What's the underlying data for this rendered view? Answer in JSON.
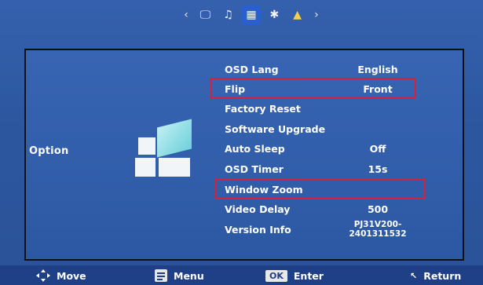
{
  "top_tabs": [
    {
      "name": "display",
      "glyph": "🖵"
    },
    {
      "name": "audio",
      "glyph": "♫"
    },
    {
      "name": "option",
      "glyph": "▦"
    },
    {
      "name": "bluetooth",
      "glyph": "✱"
    },
    {
      "name": "picture",
      "glyph": "▲"
    }
  ],
  "top_arrows": {
    "left": "‹",
    "right": "›"
  },
  "category": "Option",
  "menu": [
    {
      "label": "OSD Lang",
      "value": "English"
    },
    {
      "label": "Flip",
      "value": "Front"
    },
    {
      "label": "Factory Reset",
      "value": ""
    },
    {
      "label": "Software Upgrade",
      "value": ""
    },
    {
      "label": "Auto Sleep",
      "value": "Off"
    },
    {
      "label": "OSD Timer",
      "value": "15s"
    },
    {
      "label": "Window Zoom",
      "value": ""
    },
    {
      "label": "Video Delay",
      "value": "500"
    },
    {
      "label": "Version Info",
      "value_line1": "PJ31V200-",
      "value_line2": "2401311532"
    }
  ],
  "bottom": {
    "move": "Move",
    "menu": "Menu",
    "ok_badge": "OK",
    "enter": "Enter",
    "return": "Return"
  },
  "colors": {
    "background": "#2f55a0",
    "highlight_border": "#d4223a",
    "active_tab": "#2a5fcf",
    "bottom_bar": "#1f3f86"
  }
}
